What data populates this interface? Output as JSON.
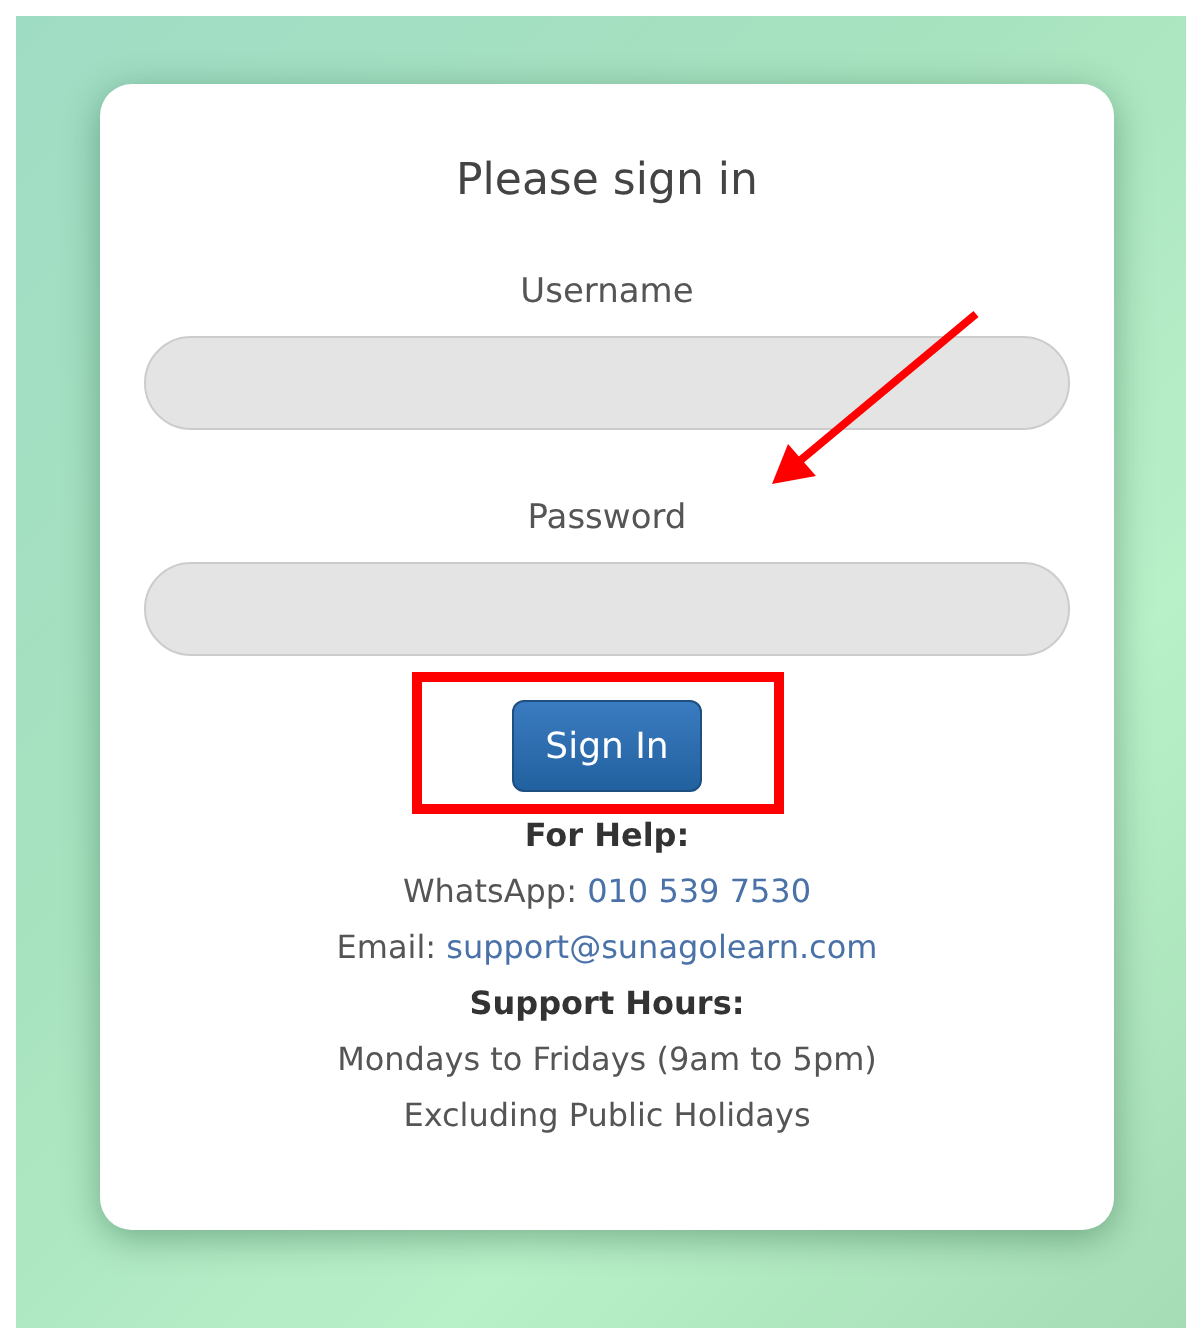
{
  "login": {
    "title": "Please sign in",
    "fields": [
      {
        "label": "Username"
      },
      {
        "label": "Password"
      }
    ],
    "button": "Sign In",
    "help": [
      {
        "kind": "heading",
        "text": "For Help:"
      },
      {
        "kind": "contact",
        "label": "WhatsApp: ",
        "value": "010 539 7530"
      },
      {
        "kind": "contact",
        "label": "Email: ",
        "value": "support@sunagolearn.com"
      },
      {
        "kind": "heading",
        "text": "Support Hours:"
      },
      {
        "kind": "text",
        "text": "Mondays to Fridays (9am to 5pm)"
      },
      {
        "kind": "text",
        "text": "Excluding Public Holidays"
      }
    ]
  }
}
